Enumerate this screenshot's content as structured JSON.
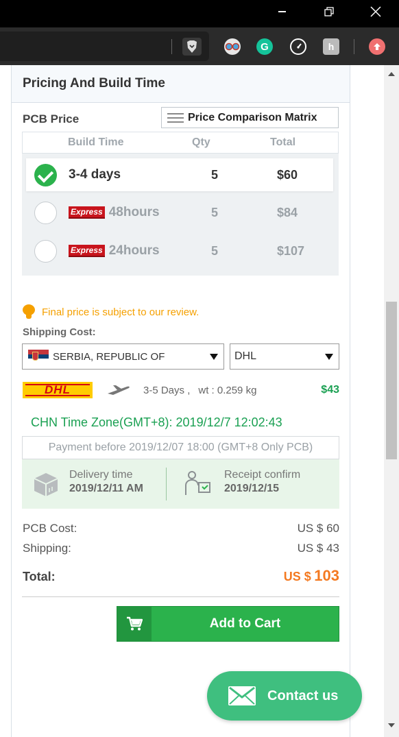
{
  "window": {
    "minimize": "—",
    "restore": "❐",
    "close": "✕"
  },
  "extensions": [
    "brave-icon",
    "glasses-icon",
    "grammarly-icon",
    "gauge-icon",
    "hand-icon",
    "upload-icon"
  ],
  "card": {
    "title": "Pricing And Build Time",
    "pcb_price_label": "PCB Price",
    "matrix_button": "Price Comparison Matrix",
    "table_headers": {
      "build_time": "Build Time",
      "qty": "Qty",
      "total": "Total"
    },
    "options": [
      {
        "time": "3-4 days",
        "badge": "",
        "qty": "5",
        "total": "$60",
        "selected": true
      },
      {
        "time": "48hours",
        "badge": "Express",
        "qty": "5",
        "total": "$84",
        "selected": false
      },
      {
        "time": "24hours",
        "badge": "Express",
        "qty": "5",
        "total": "$107",
        "selected": false
      }
    ],
    "note": "Final price is subject to our review.",
    "shipping_label": "Shipping Cost:",
    "country": "SERBIA, REPUBLIC OF",
    "carrier": "DHL",
    "dhl_logo": "DHL",
    "delivery_days": "3-5 Days ,",
    "weight": "wt : 0.259 kg",
    "shipping_price": "$43",
    "timezone": "CHN Time Zone(GMT+8): 2019/12/7 12:02:43",
    "payment_before": "Payment before 2019/12/07 18:00 (GMT+8 Only PCB)",
    "delivery_time_label": "Delivery time",
    "delivery_time_value": "2019/12/11 AM",
    "receipt_label": "Receipt confirm",
    "receipt_value": "2019/12/15",
    "pcb_cost_label": "PCB Cost:",
    "pcb_cost_value": "US $ 60",
    "shipping_cost_label": "Shipping:",
    "shipping_cost_value": "US $ 43",
    "total_label": "Total:",
    "total_currency": "US $",
    "total_value": "103",
    "add_to_cart": "Add to Cart"
  },
  "contact": {
    "label": "Contact us"
  },
  "colors": {
    "accent": "#2bb24c",
    "price_orange": "#f47920",
    "note": "#f5a000",
    "contact": "#3fbf7f"
  }
}
